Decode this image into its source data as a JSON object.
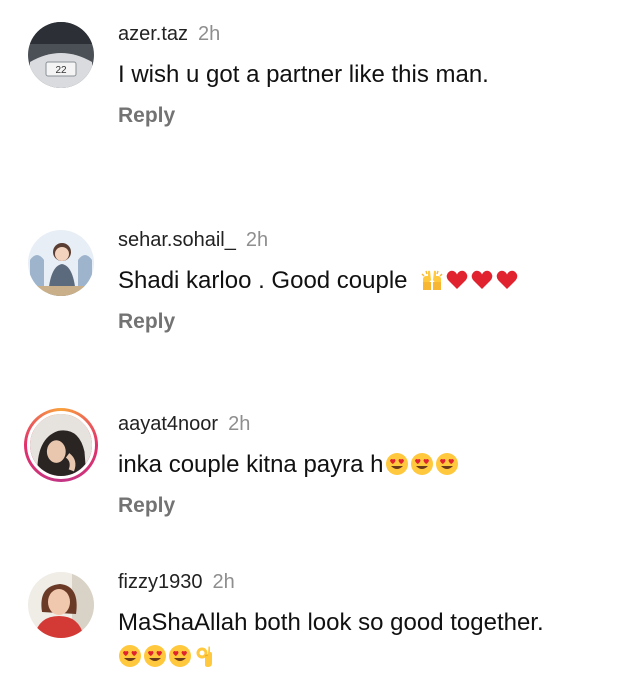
{
  "comments": [
    {
      "username": "azer.taz",
      "time": "2h",
      "text": "I wish u got a partner like this man.",
      "reply": "Reply",
      "avatar_text": "22"
    },
    {
      "username": "sehar.sohail_",
      "time": "2h",
      "text": "Shadi karloo . Good couple",
      "reply": "Reply",
      "emojis": [
        "raising-hands-icon",
        "red-heart-icon",
        "red-heart-icon",
        "red-heart-icon"
      ]
    },
    {
      "username": "aayat4noor",
      "time": "2h",
      "text": "inka couple kitna payra h",
      "reply": "Reply",
      "emojis": [
        "heart-eyes-icon",
        "heart-eyes-icon",
        "heart-eyes-icon"
      ],
      "story_ring": true
    },
    {
      "username": "fizzy1930",
      "time": "2h",
      "text": "MaShaAllah both look so good together.",
      "emojis": [
        "heart-eyes-icon",
        "heart-eyes-icon",
        "heart-eyes-icon",
        "ok-hand-icon"
      ]
    }
  ],
  "colors": {
    "meta_gray": "#8e8e8e",
    "reply_gray": "#737373",
    "heart_red": "#e0232e",
    "emoji_yellow": "#ffc83d"
  }
}
